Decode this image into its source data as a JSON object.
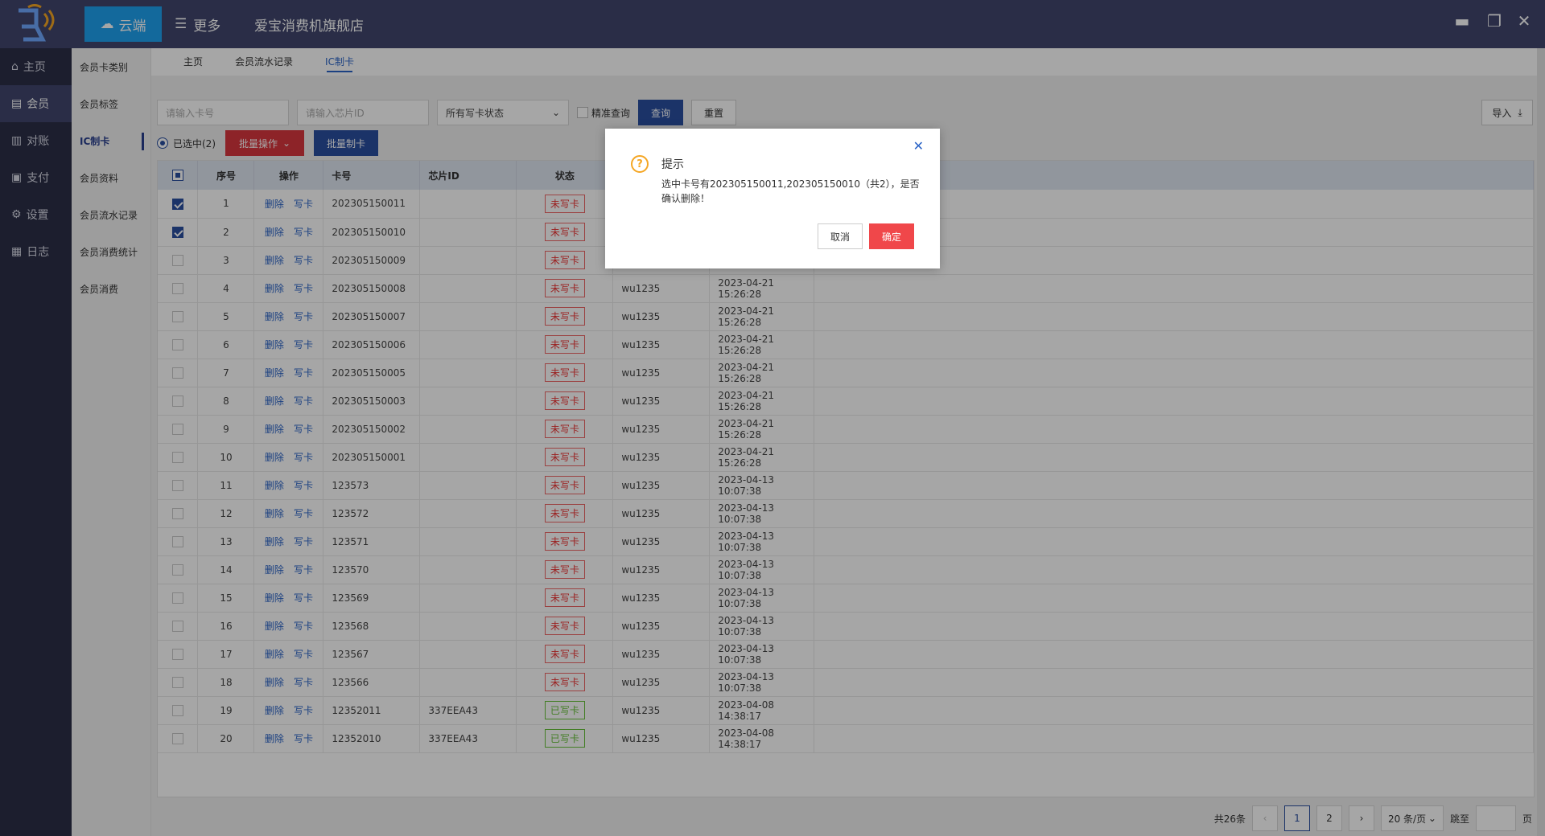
{
  "app": {
    "cloud_label": "云端",
    "more_label": "更多",
    "store_name": "爱宝消费机旗舰店"
  },
  "leftnav": [
    {
      "label": "主页",
      "icon": "home-icon"
    },
    {
      "label": "会员",
      "icon": "member-icon",
      "active": true
    },
    {
      "label": "对账",
      "icon": "reconcile-icon"
    },
    {
      "label": "支付",
      "icon": "payment-icon"
    },
    {
      "label": "设置",
      "icon": "gear-icon"
    },
    {
      "label": "日志",
      "icon": "log-icon"
    }
  ],
  "subnav": [
    "会员卡类别",
    "会员标签",
    "IC制卡",
    "会员资料",
    "会员流水记录",
    "会员消费统计",
    "会员消费"
  ],
  "tabs": [
    "主页",
    "会员流水记录",
    "IC制卡"
  ],
  "search": {
    "card_placeholder": "请输入卡号",
    "chip_placeholder": "请输入芯片ID",
    "status_select": "所有写卡状态",
    "exact_label": "精准查询",
    "query_label": "查询",
    "reset_label": "重置",
    "import_label": "导入"
  },
  "batch": {
    "selected_label": "已选中(2)",
    "batch_ops_label": "批量操作",
    "batch_card_label": "批量制卡"
  },
  "table": {
    "headers": [
      "序号",
      "操作",
      "卡号",
      "芯片ID",
      "状态"
    ],
    "action_delete": "删除",
    "action_write": "写卡",
    "rows": [
      {
        "no": "1",
        "card": "202305150011",
        "chip": "",
        "status": "未写卡",
        "written": false,
        "user": "",
        "time": "",
        "checked": true
      },
      {
        "no": "2",
        "card": "202305150010",
        "chip": "",
        "status": "未写卡",
        "written": false,
        "user": "",
        "time": "",
        "checked": true
      },
      {
        "no": "3",
        "card": "202305150009",
        "chip": "",
        "status": "未写卡",
        "written": false,
        "user": "",
        "time": "",
        "checked": false
      },
      {
        "no": "4",
        "card": "202305150008",
        "chip": "",
        "status": "未写卡",
        "written": false,
        "user": "wu1235",
        "time": "2023-04-21 15:26:28",
        "checked": false
      },
      {
        "no": "5",
        "card": "202305150007",
        "chip": "",
        "status": "未写卡",
        "written": false,
        "user": "wu1235",
        "time": "2023-04-21 15:26:28",
        "checked": false
      },
      {
        "no": "6",
        "card": "202305150006",
        "chip": "",
        "status": "未写卡",
        "written": false,
        "user": "wu1235",
        "time": "2023-04-21 15:26:28",
        "checked": false
      },
      {
        "no": "7",
        "card": "202305150005",
        "chip": "",
        "status": "未写卡",
        "written": false,
        "user": "wu1235",
        "time": "2023-04-21 15:26:28",
        "checked": false
      },
      {
        "no": "8",
        "card": "202305150003",
        "chip": "",
        "status": "未写卡",
        "written": false,
        "user": "wu1235",
        "time": "2023-04-21 15:26:28",
        "checked": false
      },
      {
        "no": "9",
        "card": "202305150002",
        "chip": "",
        "status": "未写卡",
        "written": false,
        "user": "wu1235",
        "time": "2023-04-21 15:26:28",
        "checked": false
      },
      {
        "no": "10",
        "card": "202305150001",
        "chip": "",
        "status": "未写卡",
        "written": false,
        "user": "wu1235",
        "time": "2023-04-21 15:26:28",
        "checked": false
      },
      {
        "no": "11",
        "card": "123573",
        "chip": "",
        "status": "未写卡",
        "written": false,
        "user": "wu1235",
        "time": "2023-04-13 10:07:38",
        "checked": false
      },
      {
        "no": "12",
        "card": "123572",
        "chip": "",
        "status": "未写卡",
        "written": false,
        "user": "wu1235",
        "time": "2023-04-13 10:07:38",
        "checked": false
      },
      {
        "no": "13",
        "card": "123571",
        "chip": "",
        "status": "未写卡",
        "written": false,
        "user": "wu1235",
        "time": "2023-04-13 10:07:38",
        "checked": false
      },
      {
        "no": "14",
        "card": "123570",
        "chip": "",
        "status": "未写卡",
        "written": false,
        "user": "wu1235",
        "time": "2023-04-13 10:07:38",
        "checked": false
      },
      {
        "no": "15",
        "card": "123569",
        "chip": "",
        "status": "未写卡",
        "written": false,
        "user": "wu1235",
        "time": "2023-04-13 10:07:38",
        "checked": false
      },
      {
        "no": "16",
        "card": "123568",
        "chip": "",
        "status": "未写卡",
        "written": false,
        "user": "wu1235",
        "time": "2023-04-13 10:07:38",
        "checked": false
      },
      {
        "no": "17",
        "card": "123567",
        "chip": "",
        "status": "未写卡",
        "written": false,
        "user": "wu1235",
        "time": "2023-04-13 10:07:38",
        "checked": false
      },
      {
        "no": "18",
        "card": "123566",
        "chip": "",
        "status": "未写卡",
        "written": false,
        "user": "wu1235",
        "time": "2023-04-13 10:07:38",
        "checked": false
      },
      {
        "no": "19",
        "card": "12352011",
        "chip": "337EEA43",
        "status": "已写卡",
        "written": true,
        "user": "wu1235",
        "time": "2023-04-08 14:38:17",
        "checked": false
      },
      {
        "no": "20",
        "card": "12352010",
        "chip": "337EEA43",
        "status": "已写卡",
        "written": true,
        "user": "wu1235",
        "time": "2023-04-08 14:38:17",
        "checked": false
      }
    ]
  },
  "pager": {
    "total": "共26条",
    "pages": [
      "1",
      "2"
    ],
    "current": "1",
    "size": "20 条/页",
    "jump": "跳至",
    "page_suffix": "页"
  },
  "dialog": {
    "title": "提示",
    "message": "选中卡号有202305150011,202305150010（共2），是否确认删除！",
    "cancel": "取消",
    "confirm": "确定"
  },
  "colors": {
    "titlebar": "#41466e",
    "accent": "#2a4fa0",
    "cloud": "#1ea1f0",
    "danger": "#d9363e",
    "confirm": "#f0474a"
  }
}
